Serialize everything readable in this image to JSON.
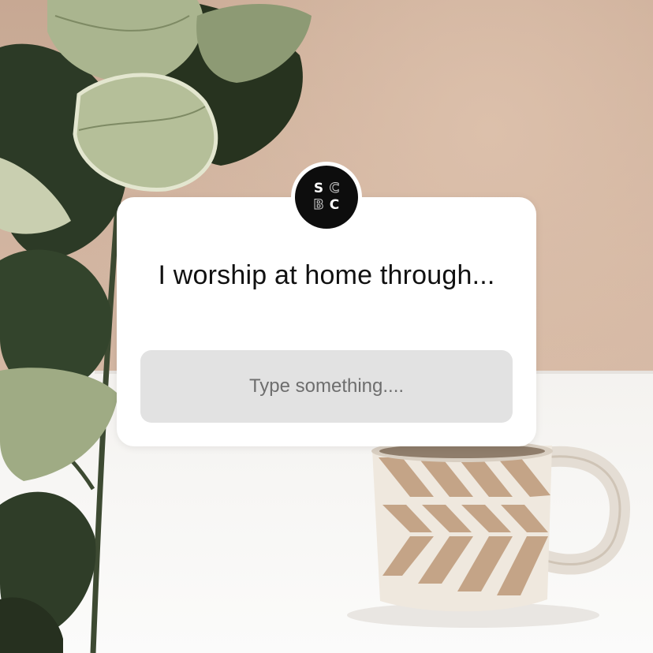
{
  "story_sticker": {
    "question": "I worship at home through...",
    "answer_placeholder": "Type something....",
    "avatar": {
      "logo_letters": [
        "S",
        "C",
        "B",
        "C"
      ],
      "background_color": "#0d0d0d"
    }
  },
  "colors": {
    "card_background": "#ffffff",
    "answer_box_background": "#e2e2e2",
    "question_text": "#111111",
    "placeholder_text": "#6e6e6e"
  }
}
